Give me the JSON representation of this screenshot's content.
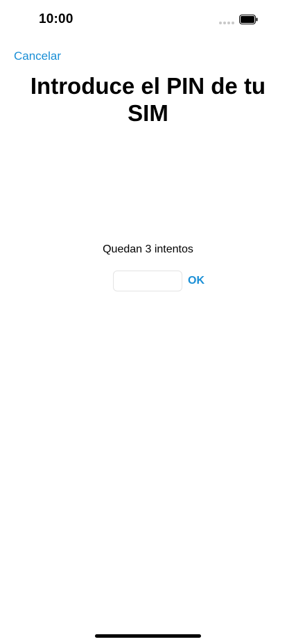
{
  "status_bar": {
    "time": "10:00",
    "signal_icon": "signal-dots-icon",
    "battery_icon": "battery-full-icon"
  },
  "navigation": {
    "cancel_label": "Cancelar"
  },
  "title": "Introduce el PIN de tu SIM",
  "attempts_text": "Quedan 3 intentos",
  "pin_field": {
    "value": "",
    "placeholder": ""
  },
  "ok_label": "OK",
  "colors": {
    "accent": "#1a8fd6",
    "text": "#000000",
    "background": "#ffffff"
  }
}
